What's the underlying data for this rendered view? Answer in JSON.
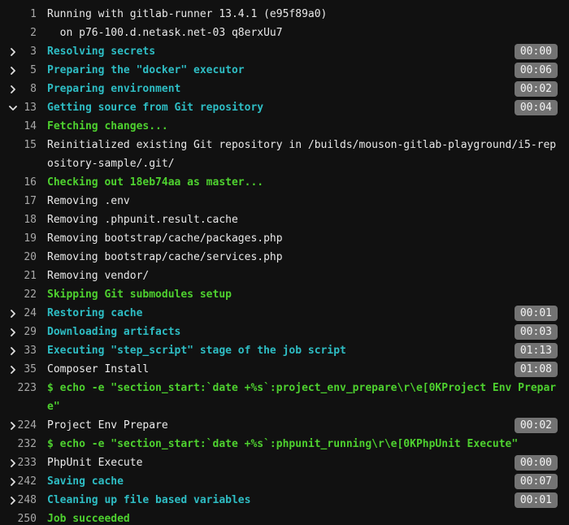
{
  "lines": [
    {
      "num": "1",
      "text": "Running with gitlab-runner 13.4.1 (e95f89a0)",
      "style": "white"
    },
    {
      "num": "2",
      "text": "  on p76-100.d.netask.net-03 q8erxUu7",
      "style": "white"
    },
    {
      "num": "3",
      "text": "Resolving secrets",
      "style": "section",
      "toggle": "collapsed",
      "duration": "00:00"
    },
    {
      "num": "5",
      "text": "Preparing the \"docker\" executor",
      "style": "section",
      "toggle": "collapsed",
      "duration": "00:06"
    },
    {
      "num": "8",
      "text": "Preparing environment",
      "style": "section",
      "toggle": "collapsed",
      "duration": "00:02"
    },
    {
      "num": "13",
      "text": "Getting source from Git repository",
      "style": "section",
      "toggle": "expanded",
      "duration": "00:04"
    },
    {
      "num": "14",
      "text": "Fetching changes...",
      "style": "green"
    },
    {
      "num": "15",
      "text": "Reinitialized existing Git repository in /builds/mouson-gitlab-playground/i5-repository-sample/.git/",
      "style": "white",
      "wrap": true
    },
    {
      "num": "16",
      "text": "Checking out 18eb74aa as master...",
      "style": "green"
    },
    {
      "num": "17",
      "text": "Removing .env",
      "style": "white"
    },
    {
      "num": "18",
      "text": "Removing .phpunit.result.cache",
      "style": "white"
    },
    {
      "num": "19",
      "text": "Removing bootstrap/cache/packages.php",
      "style": "white"
    },
    {
      "num": "20",
      "text": "Removing bootstrap/cache/services.php",
      "style": "white"
    },
    {
      "num": "21",
      "text": "Removing vendor/",
      "style": "white"
    },
    {
      "num": "22",
      "text": "Skipping Git submodules setup",
      "style": "green"
    },
    {
      "num": "24",
      "text": "Restoring cache",
      "style": "section",
      "toggle": "collapsed",
      "duration": "00:01"
    },
    {
      "num": "29",
      "text": "Downloading artifacts",
      "style": "section",
      "toggle": "collapsed",
      "duration": "00:03"
    },
    {
      "num": "33",
      "text": "Executing \"step_script\" stage of the job script",
      "style": "section",
      "toggle": "collapsed",
      "duration": "01:13"
    },
    {
      "num": "35",
      "text": "Composer Install",
      "style": "plain",
      "toggle": "collapsed",
      "duration": "01:08"
    },
    {
      "num": "223",
      "text": "$ echo -e \"section_start:`date +%s`:project_env_prepare\\r\\e[0KProject Env Prepare\"",
      "style": "green",
      "wrap": true
    },
    {
      "num": "224",
      "text": "Project Env Prepare",
      "style": "plain",
      "toggle": "collapsed",
      "duration": "00:02"
    },
    {
      "num": "232",
      "text": "$ echo -e \"section_start:`date +%s`:phpunit_running\\r\\e[0KPhpUnit Execute\"",
      "style": "green"
    },
    {
      "num": "233",
      "text": "PhpUnit Execute",
      "style": "plain",
      "toggle": "collapsed",
      "duration": "00:00"
    },
    {
      "num": "242",
      "text": "Saving cache",
      "style": "section",
      "toggle": "collapsed",
      "duration": "00:07"
    },
    {
      "num": "248",
      "text": "Cleaning up file based variables",
      "style": "section",
      "toggle": "collapsed",
      "duration": "00:01"
    },
    {
      "num": "250",
      "text": "Job succeeded",
      "style": "green"
    }
  ]
}
